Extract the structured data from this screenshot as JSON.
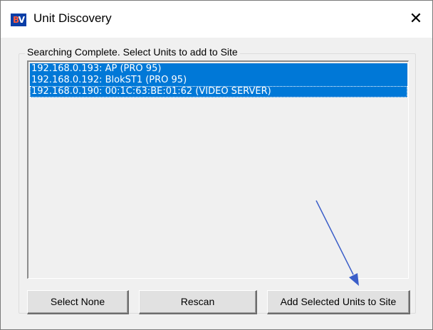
{
  "window": {
    "title": "Unit Discovery",
    "icon_text": "BV",
    "close_glyph": "✕"
  },
  "group": {
    "label": "Searching Complete. Select Units to add to Site"
  },
  "units": [
    "192.168.0.193: AP (PRO 95)",
    "192.168.0.192: BlokST1 (PRO 95)",
    "192.168.0.190: 00:1C:63:BE:01:62 (VIDEO SERVER)"
  ],
  "buttons": {
    "select_none": "Select None",
    "rescan": "Rescan",
    "add_selected": "Add Selected Units to Site"
  },
  "colors": {
    "selection": "#0078d7",
    "annotation_arrow": "#3b5ec9"
  }
}
